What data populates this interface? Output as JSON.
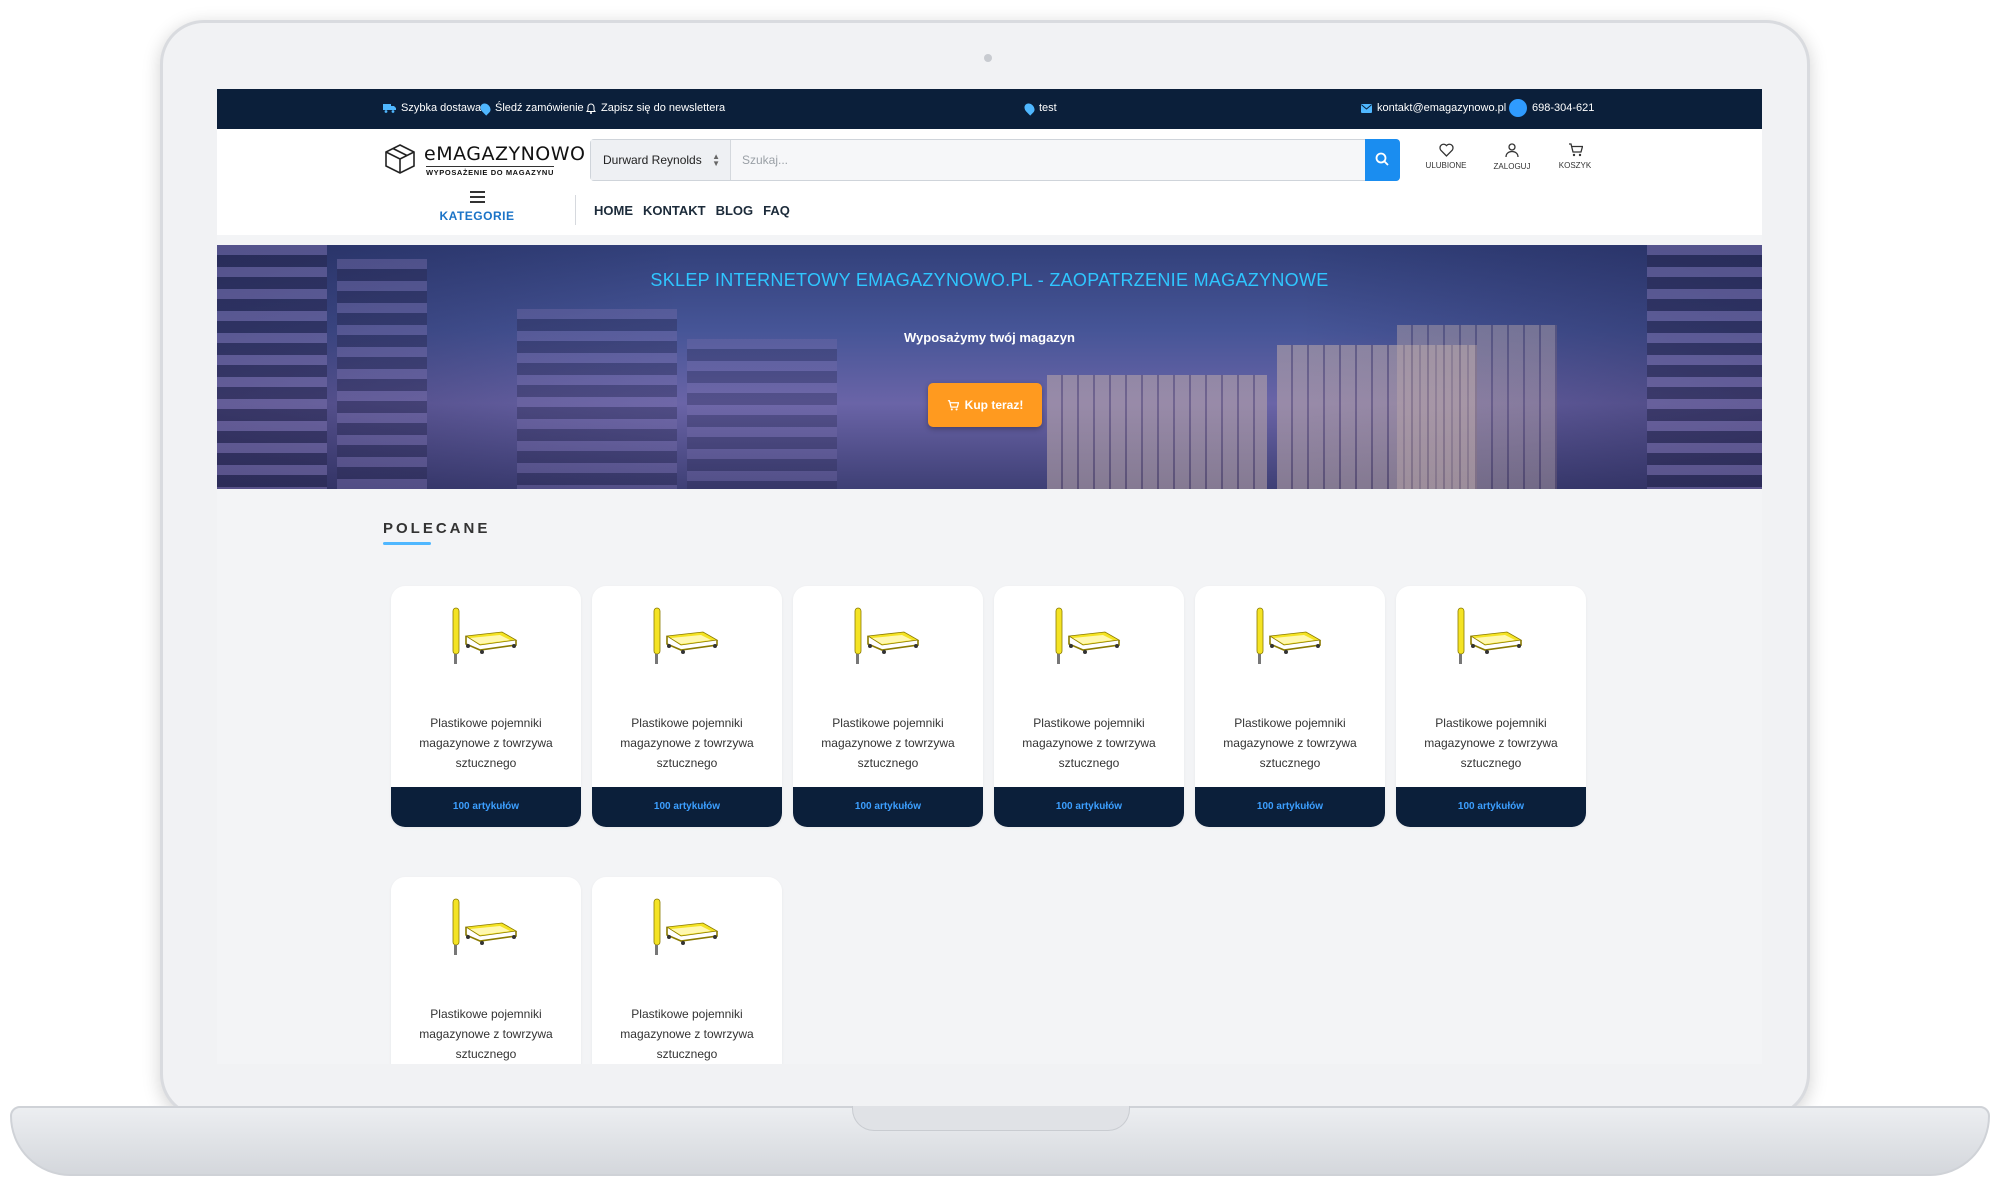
{
  "topbar": {
    "fast_delivery": "Szybka dostawa",
    "track_order": "Śledź zamówienie",
    "newsletter": "Zapisz się do newslettera",
    "location": "test",
    "email": "kontakt@emagazynowo.pl",
    "phone": "698-304-621"
  },
  "logo": {
    "title": "eMAGAZYNOWO",
    "subtitle": "WYPOSAŻENIE DO MAGAZYNU"
  },
  "search": {
    "category_selected": "Durward Reynolds",
    "placeholder": "Szukaj..."
  },
  "header_actions": {
    "favorites": "ULUBIONE",
    "login": "ZALOGUJ",
    "cart": "KOSZYK"
  },
  "nav": {
    "categories": "KATEGORIE",
    "links": [
      "HOME",
      "KONTAKT",
      "BLOG",
      "FAQ"
    ]
  },
  "hero": {
    "title": "SKLEP INTERNETOWY EMAGAZYNOWO.PL - ZAOPATRZENIE MAGAZYNOWE",
    "subtitle": "Wyposażymy twój magazyn",
    "button": "Kup teraz!"
  },
  "featured": {
    "title": "POLECANE",
    "products": [
      {
        "name_line1": "Plastikowe pojemniki",
        "name_line2": "magazynowe z towrzywa",
        "name_line3": "sztucznego",
        "count": "100 artykułów"
      },
      {
        "name_line1": "Plastikowe pojemniki",
        "name_line2": "magazynowe z towrzywa",
        "name_line3": "sztucznego",
        "count": "100 artykułów"
      },
      {
        "name_line1": "Plastikowe pojemniki",
        "name_line2": "magazynowe z towrzywa",
        "name_line3": "sztucznego",
        "count": "100 artykułów"
      },
      {
        "name_line1": "Plastikowe pojemniki",
        "name_line2": "magazynowe z towrzywa",
        "name_line3": "sztucznego",
        "count": "100 artykułów"
      },
      {
        "name_line1": "Plastikowe pojemniki",
        "name_line2": "magazynowe z towrzywa",
        "name_line3": "sztucznego",
        "count": "100 artykułów"
      },
      {
        "name_line1": "Plastikowe pojemniki",
        "name_line2": "magazynowe z towrzywa",
        "name_line3": "sztucznego",
        "count": "100 artykułów"
      },
      {
        "name_line1": "Plastikowe pojemniki",
        "name_line2": "magazynowe z towrzywa",
        "name_line3": "sztucznego"
      },
      {
        "name_line1": "Plastikowe pojemniki",
        "name_line2": "magazynowe z towrzywa",
        "name_line3": "sztucznego"
      }
    ]
  },
  "colors": {
    "topbar_bg": "#0b1f3a",
    "accent_blue": "#1a8df0",
    "hero_button": "#ff9a1f",
    "hero_title": "#2fc6ff"
  }
}
